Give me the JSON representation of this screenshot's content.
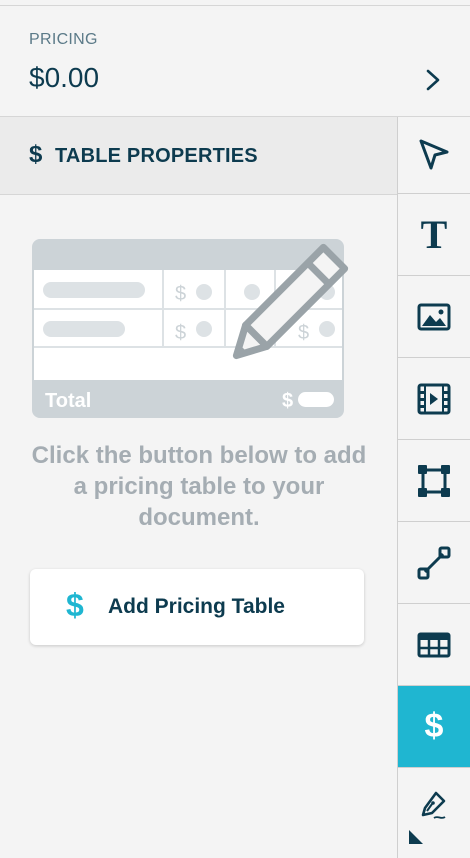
{
  "pricing": {
    "label": "PRICING",
    "value": "$0.00"
  },
  "properties": {
    "icon_symbol": "$",
    "title": "TABLE PROPERTIES"
  },
  "illustration": {
    "currency_symbol": "$",
    "total_label": "Total"
  },
  "empty_state": {
    "message": "Click the button below to add a pricing table to your document."
  },
  "add_button": {
    "icon_symbol": "$",
    "label": "Add Pricing Table"
  },
  "toolbar": {
    "active_tool": "pricing",
    "text_tool_glyph": "T",
    "pricing_tool_glyph": "$",
    "tools": [
      "select-tool",
      "text-tool",
      "image-tool",
      "video-tool",
      "shape-tool",
      "line-tool",
      "table-tool",
      "pricing-tool",
      "signature-tool"
    ]
  },
  "colors": {
    "accent": "#1fb6d1",
    "dark_text": "#0d3b4f",
    "muted_text": "#a5adb3",
    "background": "#f4f4f4"
  }
}
